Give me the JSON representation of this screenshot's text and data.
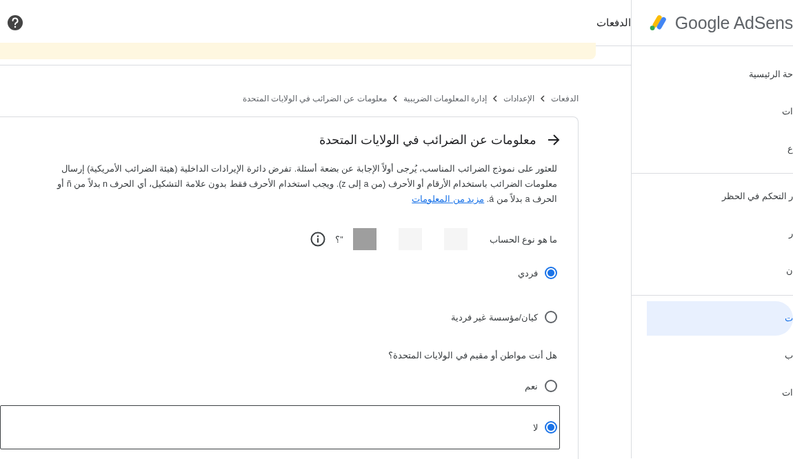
{
  "header": {
    "logo_text": "Google AdSens",
    "title": "الدفعات"
  },
  "sidebar": {
    "groups": [
      [
        {
          "label": "حة الرئيسية",
          "selected": false
        },
        {
          "label": "ات",
          "selected": false
        },
        {
          "label": "ع",
          "selected": false
        }
      ],
      [
        {
          "label": "ر التحكم في الحظر",
          "selected": false
        },
        {
          "label": "ر",
          "selected": false
        },
        {
          "label": "ن",
          "selected": false
        }
      ],
      [
        {
          "label": "ت",
          "selected": true
        },
        {
          "label": "ب",
          "selected": false
        },
        {
          "label": "ات",
          "selected": false
        }
      ]
    ]
  },
  "breadcrumbs": [
    "الدفعات",
    "الإعدادات",
    "إدارة المعلومات الضريبية",
    "معلومات عن الضرائب في الولايات المتحدة"
  ],
  "card": {
    "title": "معلومات عن الضرائب في الولايات المتحدة",
    "description": "للعثور على نموذج الضرائب المناسب، يُرجى أولاً الإجابة عن بضعة أسئلة. تفرض دائرة الإيرادات الداخلية (هيئة الضرائب الأمريكية) إرسال معلومات الضرائب باستخدام الأرقام أو الأحرف (من a إلى z). ويجب استخدام الأحرف فقط بدون علامة التشكيل، أي الحرف n بدلاً من ñ أو الحرف a بدلاً من á.",
    "link": "مزيد من المعلومات",
    "questions": [
      {
        "label": "ما هو نوع الحساب",
        "suffix": "\"؟",
        "info": true,
        "choices": [
          {
            "label": "فردي",
            "selected": true
          },
          {
            "label": "كيان/مؤسسة غير فردية",
            "selected": false
          }
        ]
      },
      {
        "label": "هل أنت مواطن أو مقيم في الولايات المتحدة؟",
        "choices": [
          {
            "label": "نعم",
            "selected": false
          },
          {
            "label": "لا",
            "selected": true
          }
        ]
      }
    ]
  }
}
